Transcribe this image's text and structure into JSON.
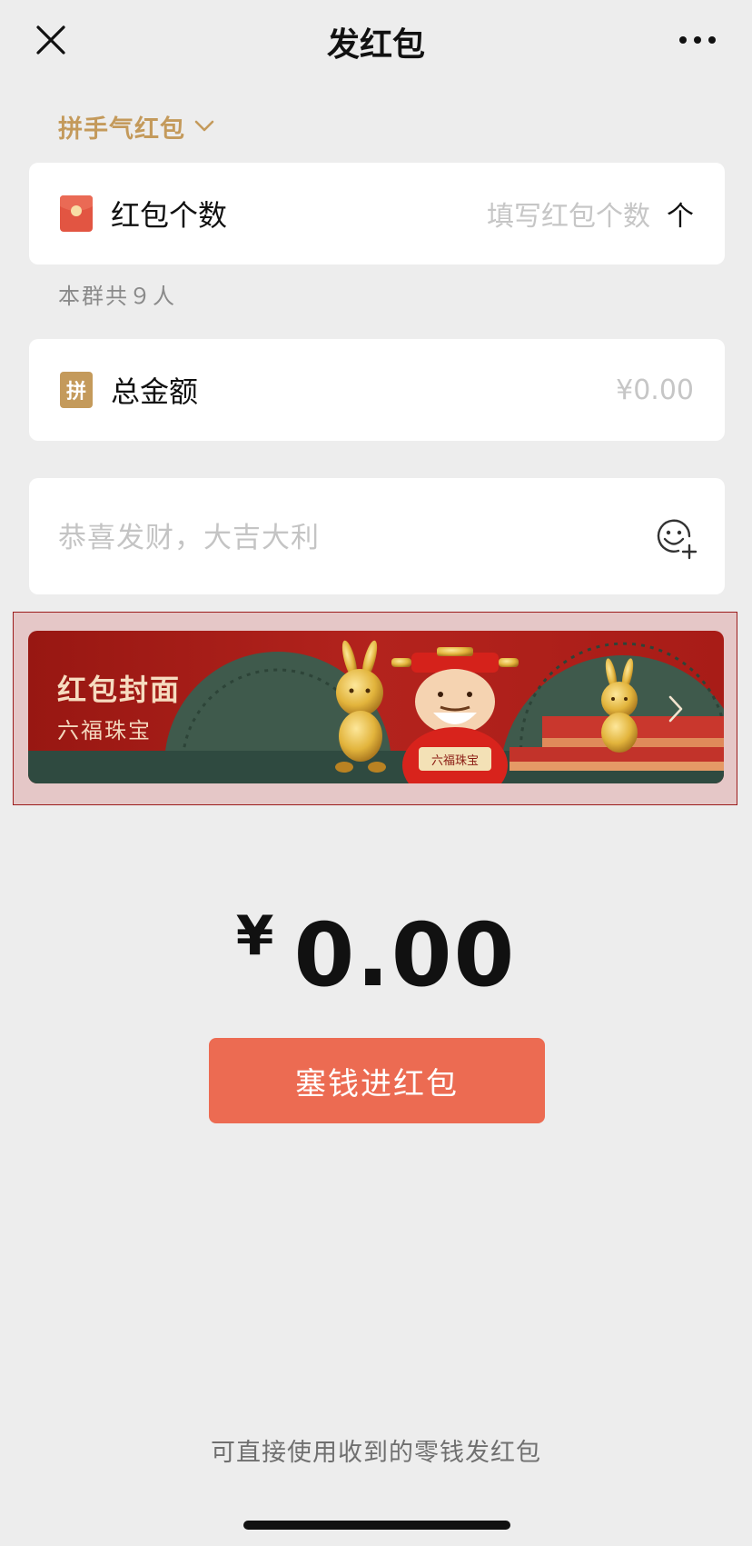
{
  "nav": {
    "title": "发红包",
    "close_icon": "close-icon",
    "more_icon": "more-dots-icon"
  },
  "packet_type": {
    "label": "拼手气红包",
    "icon": "chevron-down-icon"
  },
  "count_row": {
    "label": "红包个数",
    "placeholder": "填写红包个数",
    "unit": "个",
    "icon": "red-envelope-icon"
  },
  "group_hint": "本群共９人",
  "amount_row": {
    "label": "总金额",
    "icon_text": "拼",
    "value_placeholder": "¥0.00"
  },
  "greeting": {
    "placeholder": "恭喜发财，大吉大利",
    "icon": "emoji-add-icon"
  },
  "cover": {
    "title": "红包封面",
    "subtitle": "六福珠宝",
    "sign_text": "六福珠宝",
    "icon": "chevron-right-icon"
  },
  "amount_display": {
    "symbol": "¥",
    "value": "0.00"
  },
  "submit_button": "塞钱进红包",
  "footer_note": "可直接使用收到的零钱发红包",
  "colors": {
    "background": "#ededed",
    "accent_gold": "#c49a5b",
    "button_red": "#ec6b52",
    "cover_red": "#b1221d"
  }
}
